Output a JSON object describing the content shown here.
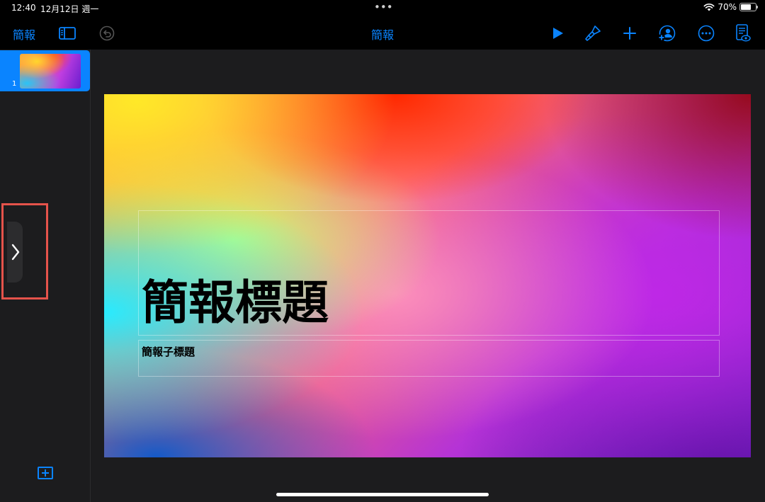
{
  "status_bar": {
    "time": "12:40",
    "date": "12月12日 週一",
    "multitask_dots": "•••",
    "battery_percent": "70%",
    "battery_level": 0.7
  },
  "toolbar": {
    "back_label": "簡報",
    "document_title": "簡報",
    "accent_color": "#0a84ff",
    "icons": [
      "sidebar-toggle-icon",
      "undo-icon",
      "play-icon",
      "format-brush-icon",
      "add-icon",
      "collaborate-icon",
      "more-icon",
      "presenter-notes-icon"
    ]
  },
  "navigator": {
    "slides": [
      {
        "number": "1",
        "selected": true
      }
    ]
  },
  "slide": {
    "title": "簡報標題",
    "subtitle": "簡報子標題"
  },
  "highlight_color": "#e5534b"
}
